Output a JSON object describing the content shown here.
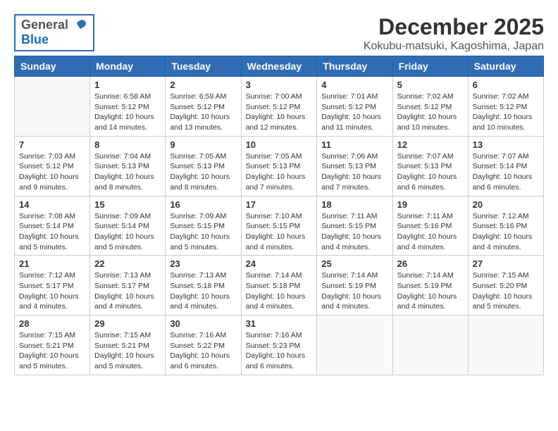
{
  "logo": {
    "general": "General",
    "blue": "Blue"
  },
  "title": "December 2025",
  "location": "Kokubu-matsuki, Kagoshima, Japan",
  "weekdays": [
    "Sunday",
    "Monday",
    "Tuesday",
    "Wednesday",
    "Thursday",
    "Friday",
    "Saturday"
  ],
  "weeks": [
    [
      {
        "day": "",
        "sunrise": "",
        "sunset": "",
        "daylight": ""
      },
      {
        "day": "1",
        "sunrise": "Sunrise: 6:58 AM",
        "sunset": "Sunset: 5:12 PM",
        "daylight": "Daylight: 10 hours and 14 minutes."
      },
      {
        "day": "2",
        "sunrise": "Sunrise: 6:59 AM",
        "sunset": "Sunset: 5:12 PM",
        "daylight": "Daylight: 10 hours and 13 minutes."
      },
      {
        "day": "3",
        "sunrise": "Sunrise: 7:00 AM",
        "sunset": "Sunset: 5:12 PM",
        "daylight": "Daylight: 10 hours and 12 minutes."
      },
      {
        "day": "4",
        "sunrise": "Sunrise: 7:01 AM",
        "sunset": "Sunset: 5:12 PM",
        "daylight": "Daylight: 10 hours and 11 minutes."
      },
      {
        "day": "5",
        "sunrise": "Sunrise: 7:02 AM",
        "sunset": "Sunset: 5:12 PM",
        "daylight": "Daylight: 10 hours and 10 minutes."
      },
      {
        "day": "6",
        "sunrise": "Sunrise: 7:02 AM",
        "sunset": "Sunset: 5:12 PM",
        "daylight": "Daylight: 10 hours and 10 minutes."
      }
    ],
    [
      {
        "day": "7",
        "sunrise": "Sunrise: 7:03 AM",
        "sunset": "Sunset: 5:12 PM",
        "daylight": "Daylight: 10 hours and 9 minutes."
      },
      {
        "day": "8",
        "sunrise": "Sunrise: 7:04 AM",
        "sunset": "Sunset: 5:13 PM",
        "daylight": "Daylight: 10 hours and 8 minutes."
      },
      {
        "day": "9",
        "sunrise": "Sunrise: 7:05 AM",
        "sunset": "Sunset: 5:13 PM",
        "daylight": "Daylight: 10 hours and 8 minutes."
      },
      {
        "day": "10",
        "sunrise": "Sunrise: 7:05 AM",
        "sunset": "Sunset: 5:13 PM",
        "daylight": "Daylight: 10 hours and 7 minutes."
      },
      {
        "day": "11",
        "sunrise": "Sunrise: 7:06 AM",
        "sunset": "Sunset: 5:13 PM",
        "daylight": "Daylight: 10 hours and 7 minutes."
      },
      {
        "day": "12",
        "sunrise": "Sunrise: 7:07 AM",
        "sunset": "Sunset: 5:13 PM",
        "daylight": "Daylight: 10 hours and 6 minutes."
      },
      {
        "day": "13",
        "sunrise": "Sunrise: 7:07 AM",
        "sunset": "Sunset: 5:14 PM",
        "daylight": "Daylight: 10 hours and 6 minutes."
      }
    ],
    [
      {
        "day": "14",
        "sunrise": "Sunrise: 7:08 AM",
        "sunset": "Sunset: 5:14 PM",
        "daylight": "Daylight: 10 hours and 5 minutes."
      },
      {
        "day": "15",
        "sunrise": "Sunrise: 7:09 AM",
        "sunset": "Sunset: 5:14 PM",
        "daylight": "Daylight: 10 hours and 5 minutes."
      },
      {
        "day": "16",
        "sunrise": "Sunrise: 7:09 AM",
        "sunset": "Sunset: 5:15 PM",
        "daylight": "Daylight: 10 hours and 5 minutes."
      },
      {
        "day": "17",
        "sunrise": "Sunrise: 7:10 AM",
        "sunset": "Sunset: 5:15 PM",
        "daylight": "Daylight: 10 hours and 4 minutes."
      },
      {
        "day": "18",
        "sunrise": "Sunrise: 7:11 AM",
        "sunset": "Sunset: 5:15 PM",
        "daylight": "Daylight: 10 hours and 4 minutes."
      },
      {
        "day": "19",
        "sunrise": "Sunrise: 7:11 AM",
        "sunset": "Sunset: 5:16 PM",
        "daylight": "Daylight: 10 hours and 4 minutes."
      },
      {
        "day": "20",
        "sunrise": "Sunrise: 7:12 AM",
        "sunset": "Sunset: 5:16 PM",
        "daylight": "Daylight: 10 hours and 4 minutes."
      }
    ],
    [
      {
        "day": "21",
        "sunrise": "Sunrise: 7:12 AM",
        "sunset": "Sunset: 5:17 PM",
        "daylight": "Daylight: 10 hours and 4 minutes."
      },
      {
        "day": "22",
        "sunrise": "Sunrise: 7:13 AM",
        "sunset": "Sunset: 5:17 PM",
        "daylight": "Daylight: 10 hours and 4 minutes."
      },
      {
        "day": "23",
        "sunrise": "Sunrise: 7:13 AM",
        "sunset": "Sunset: 5:18 PM",
        "daylight": "Daylight: 10 hours and 4 minutes."
      },
      {
        "day": "24",
        "sunrise": "Sunrise: 7:14 AM",
        "sunset": "Sunset: 5:18 PM",
        "daylight": "Daylight: 10 hours and 4 minutes."
      },
      {
        "day": "25",
        "sunrise": "Sunrise: 7:14 AM",
        "sunset": "Sunset: 5:19 PM",
        "daylight": "Daylight: 10 hours and 4 minutes."
      },
      {
        "day": "26",
        "sunrise": "Sunrise: 7:14 AM",
        "sunset": "Sunset: 5:19 PM",
        "daylight": "Daylight: 10 hours and 4 minutes."
      },
      {
        "day": "27",
        "sunrise": "Sunrise: 7:15 AM",
        "sunset": "Sunset: 5:20 PM",
        "daylight": "Daylight: 10 hours and 5 minutes."
      }
    ],
    [
      {
        "day": "28",
        "sunrise": "Sunrise: 7:15 AM",
        "sunset": "Sunset: 5:21 PM",
        "daylight": "Daylight: 10 hours and 5 minutes."
      },
      {
        "day": "29",
        "sunrise": "Sunrise: 7:15 AM",
        "sunset": "Sunset: 5:21 PM",
        "daylight": "Daylight: 10 hours and 5 minutes."
      },
      {
        "day": "30",
        "sunrise": "Sunrise: 7:16 AM",
        "sunset": "Sunset: 5:22 PM",
        "daylight": "Daylight: 10 hours and 6 minutes."
      },
      {
        "day": "31",
        "sunrise": "Sunrise: 7:16 AM",
        "sunset": "Sunset: 5:23 PM",
        "daylight": "Daylight: 10 hours and 6 minutes."
      },
      {
        "day": "",
        "sunrise": "",
        "sunset": "",
        "daylight": ""
      },
      {
        "day": "",
        "sunrise": "",
        "sunset": "",
        "daylight": ""
      },
      {
        "day": "",
        "sunrise": "",
        "sunset": "",
        "daylight": ""
      }
    ]
  ]
}
